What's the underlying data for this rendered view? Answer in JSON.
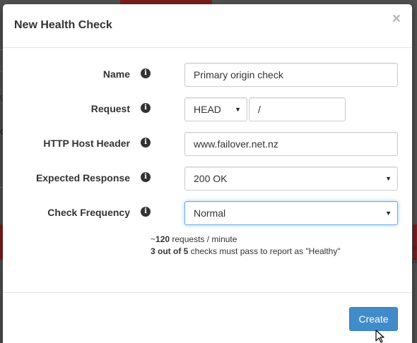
{
  "modal": {
    "title": "New Health Check",
    "close_label": "×"
  },
  "form": {
    "name": {
      "label": "Name",
      "value": "Primary origin check"
    },
    "request": {
      "label": "Request",
      "method": "HEAD",
      "path": "/"
    },
    "host_header": {
      "label": "HTTP Host Header",
      "value": "www.failover.net.nz"
    },
    "expected_response": {
      "label": "Expected Response",
      "value": "200 OK"
    },
    "check_frequency": {
      "label": "Check Frequency",
      "value": "Normal"
    }
  },
  "hint": {
    "requests_prefix": "~",
    "requests_count": "120",
    "requests_suffix": " requests / minute",
    "checks_bold": "3 out of 5",
    "checks_rest": " checks must pass to report as \"Healthy\""
  },
  "footer": {
    "create_label": "Create"
  },
  "icons": {
    "info": "info-icon",
    "caret": "caret-down-icon",
    "cursor": "mouse-pointer-icon"
  },
  "colors": {
    "primary": "#428bca",
    "focus": "#66afe9"
  },
  "background_fragments": [
    "g",
    "C",
    "u",
    "ni"
  ]
}
